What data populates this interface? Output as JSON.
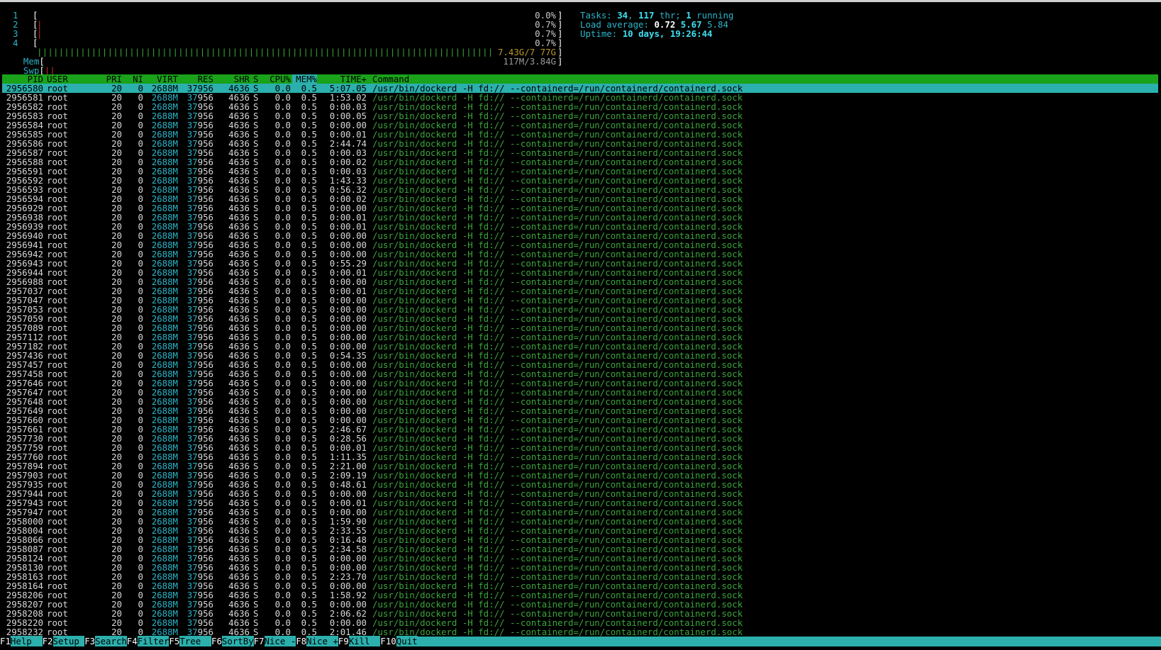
{
  "meters": {
    "cpus": [
      {
        "num": "1",
        "bar": "",
        "value": "0.0%"
      },
      {
        "num": "2",
        "bar": "|",
        "value": "0.7%"
      },
      {
        "num": "3",
        "bar": "|",
        "value": "0.7%"
      },
      {
        "num": "4",
        "bar": "",
        "value": "0.7%"
      }
    ],
    "mem": {
      "label": "Mem",
      "used": "7.43G",
      "total": "7.77G",
      "display": "7.43G/7 77G",
      "usage_fraction": 0.96
    },
    "swp": {
      "label": "Swp",
      "display": "117M/3.84G",
      "usage_fraction": 0.03
    }
  },
  "summary": {
    "tasks_label": "Tasks: ",
    "tasks": "34",
    "threads": "117",
    "thr_label": " thr; ",
    "running": "1",
    "running_label": " running",
    "load_label": "Load average: ",
    "load1": "0.72",
    "load5": "5.67",
    "load15": "5.84",
    "uptime_label": "Uptime: ",
    "uptime": "10 days, 19:26:44"
  },
  "header": {
    "pid": "PID",
    "user": "USER",
    "pri": "PRI",
    "ni": "NI",
    "virt": "VIRT",
    "res": "RES",
    "shr": "SHR",
    "s": "S",
    "cpu": "CPU%",
    "mem": "MEM%",
    "time": "TIME+",
    "command": "Command"
  },
  "process_defaults": {
    "user": "root",
    "pri": "20",
    "ni": "0",
    "virt": "2688M",
    "res": "37956",
    "shr": "4636",
    "s": "S",
    "cpu": "0.0",
    "mem": "0.5",
    "command": "/usr/bin/dockerd -H fd:// --containerd=/run/containerd/containerd.sock"
  },
  "processes": [
    {
      "pid": "2956580",
      "time": "5:07.05",
      "selected": true
    },
    {
      "pid": "2956581",
      "time": "1:53.02"
    },
    {
      "pid": "2956582",
      "time": "0:00.03"
    },
    {
      "pid": "2956583",
      "time": "0:00.05"
    },
    {
      "pid": "2956584",
      "time": "0:00.00"
    },
    {
      "pid": "2956585",
      "time": "0:00.01"
    },
    {
      "pid": "2956586",
      "time": "2:44.74"
    },
    {
      "pid": "2956587",
      "time": "0:00.03"
    },
    {
      "pid": "2956588",
      "time": "0:00.02"
    },
    {
      "pid": "2956591",
      "time": "0:00.03"
    },
    {
      "pid": "2956592",
      "time": "1:43.33"
    },
    {
      "pid": "2956593",
      "time": "0:56.32"
    },
    {
      "pid": "2956594",
      "time": "0:00.02"
    },
    {
      "pid": "2956929",
      "time": "0:00.00"
    },
    {
      "pid": "2956938",
      "time": "0:00.01"
    },
    {
      "pid": "2956939",
      "time": "0:00.01"
    },
    {
      "pid": "2956940",
      "time": "0:00.00"
    },
    {
      "pid": "2956941",
      "time": "0:00.00"
    },
    {
      "pid": "2956942",
      "time": "0:00.00"
    },
    {
      "pid": "2956943",
      "time": "0:55.29"
    },
    {
      "pid": "2956944",
      "time": "0:00.01"
    },
    {
      "pid": "2956988",
      "time": "0:00.00"
    },
    {
      "pid": "2957037",
      "time": "0:00.01"
    },
    {
      "pid": "2957047",
      "time": "0:00.00"
    },
    {
      "pid": "2957053",
      "time": "0:00.00"
    },
    {
      "pid": "2957059",
      "time": "0:00.00"
    },
    {
      "pid": "2957089",
      "time": "0:00.00"
    },
    {
      "pid": "2957112",
      "time": "0:00.00"
    },
    {
      "pid": "2957182",
      "time": "0:00.00"
    },
    {
      "pid": "2957436",
      "time": "0:54.35"
    },
    {
      "pid": "2957457",
      "time": "0:00.00"
    },
    {
      "pid": "2957458",
      "time": "0:00.00"
    },
    {
      "pid": "2957646",
      "time": "0:00.00"
    },
    {
      "pid": "2957647",
      "time": "0:00.00"
    },
    {
      "pid": "2957648",
      "time": "0:00.00"
    },
    {
      "pid": "2957649",
      "time": "0:00.00"
    },
    {
      "pid": "2957660",
      "time": "0:00.00"
    },
    {
      "pid": "2957661",
      "time": "2:46.67"
    },
    {
      "pid": "2957730",
      "time": "0:28.56"
    },
    {
      "pid": "2957759",
      "time": "0:00.01"
    },
    {
      "pid": "2957760",
      "time": "1:11.35"
    },
    {
      "pid": "2957894",
      "time": "2:21.00"
    },
    {
      "pid": "2957903",
      "time": "2:09.19"
    },
    {
      "pid": "2957935",
      "time": "0:48.61"
    },
    {
      "pid": "2957944",
      "time": "0:00.00"
    },
    {
      "pid": "2957943",
      "time": "0:00.01"
    },
    {
      "pid": "2957947",
      "time": "0:00.00"
    },
    {
      "pid": "2958000",
      "time": "1:59.90"
    },
    {
      "pid": "2958004",
      "time": "2:33.55"
    },
    {
      "pid": "2958066",
      "time": "0:16.48"
    },
    {
      "pid": "2958087",
      "time": "2:34.58"
    },
    {
      "pid": "2958124",
      "time": "0:00.00"
    },
    {
      "pid": "2958130",
      "time": "0:00.00"
    },
    {
      "pid": "2958163",
      "time": "2:23.70"
    },
    {
      "pid": "2958164",
      "time": "0:00.00"
    },
    {
      "pid": "2958206",
      "time": "1:58.92"
    },
    {
      "pid": "2958207",
      "time": "0:00.00"
    },
    {
      "pid": "2958208",
      "time": "2:06.62"
    },
    {
      "pid": "2958220",
      "time": "0:00.00"
    },
    {
      "pid": "2958232",
      "time": "2:01.46"
    }
  ],
  "function_keys": [
    {
      "key": "F1",
      "label": "Help  "
    },
    {
      "key": "F2",
      "label": "Setup "
    },
    {
      "key": "F3",
      "label": "Search"
    },
    {
      "key": "F4",
      "label": "Filter"
    },
    {
      "key": "F5",
      "label": "Tree  "
    },
    {
      "key": "F6",
      "label": "SortBy"
    },
    {
      "key": "F7",
      "label": "Nice -"
    },
    {
      "key": "F8",
      "label": "Nice +"
    },
    {
      "key": "F9",
      "label": "Kill  "
    },
    {
      "key": "F10",
      "label": "Quit"
    }
  ],
  "colors": {
    "header_bg": "#1aa21a",
    "selected_bg": "#2bb0ad",
    "command": "#3aa63a",
    "accent": "#2bb5c8"
  }
}
